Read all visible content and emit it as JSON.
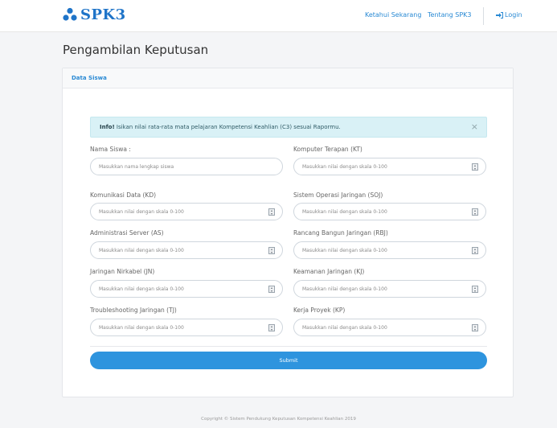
{
  "navbar": {
    "brand": "SPK3",
    "brand_icon": "hexagon-logo-icon",
    "links": [
      "Ketahui Sekarang",
      "Tentang SPK3"
    ],
    "login_label": "Login",
    "login_icon": "sign-in-icon"
  },
  "page": {
    "title": "Pengambilan Keputusan"
  },
  "panel": {
    "title": "Data Siswa"
  },
  "alert": {
    "strong": "Info!",
    "message": "Isikan nilai rata-rata mata pelajaran Kompetensi Keahlian (C3) sesuai Rapormu.",
    "close": "×"
  },
  "form": {
    "name": {
      "label": "Nama Siswa :",
      "placeholder": "Masukkan nama lengkap siswa"
    },
    "fields": [
      {
        "label": "Komputer Terapan (KT)",
        "placeholder": "Masukkan nilai dengan skala 0-100"
      },
      {
        "label": "Komunikasi Data (KD)",
        "placeholder": "Masukkan nilai dengan skala 0-100"
      },
      {
        "label": "Sistem Operasi Jaringan (SOJ)",
        "placeholder": "Masukkan nilai dengan skala 0-100"
      },
      {
        "label": "Administrasi Server (AS)",
        "placeholder": "Masukkan nilai dengan skala 0-100"
      },
      {
        "label": "Rancang Bangun Jaringan (RBJ)",
        "placeholder": "Masukkan nilai dengan skala 0-100"
      },
      {
        "label": "Jaringan Nirkabel (JN)",
        "placeholder": "Masukkan nilai dengan skala 0-100"
      },
      {
        "label": "Keamanan Jaringan (KJ)",
        "placeholder": "Masukkan nilai dengan skala 0-100"
      },
      {
        "label": "Troubleshooting Jaringan (TJ)",
        "placeholder": "Masukkan nilai dengan skala 0-100"
      },
      {
        "label": "Kerja Proyek (KP)",
        "placeholder": "Masukkan nilai dengan skala 0-100"
      }
    ],
    "submit_label": "Submit"
  },
  "footer": {
    "copyright": "Copyright © Sistem Pendukung Keputusan Kompetensi Keahlian 2019"
  },
  "colors": {
    "accent": "#2e94de",
    "brand": "#1f74c8",
    "alert_bg": "#d9f1f6"
  }
}
